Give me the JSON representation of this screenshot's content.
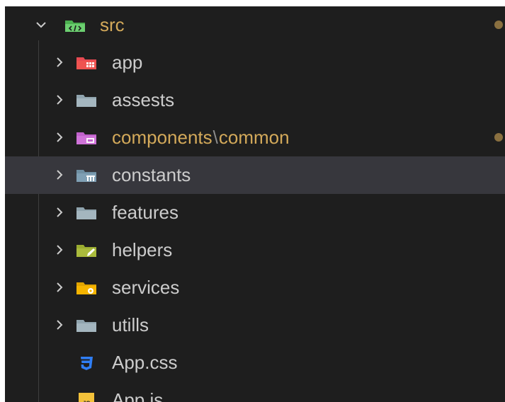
{
  "explorer": {
    "root": {
      "label": "src",
      "icon": "src-folder-icon",
      "expanded": true,
      "modified": true,
      "color": "#d3a95a"
    },
    "items": [
      {
        "label": "app",
        "type": "folder",
        "icon": "app-folder-icon",
        "icon_color": "#e84a52",
        "expanded": false
      },
      {
        "label": "assests",
        "type": "folder",
        "icon": "folder-icon",
        "icon_color": "#90a4ae",
        "expanded": false
      },
      {
        "label": "components",
        "sep": "\\",
        "label2": "common",
        "type": "folder",
        "icon": "components-folder-icon",
        "icon_color": "#c061cb",
        "expanded": false,
        "modified": true
      },
      {
        "label": "constants",
        "type": "folder",
        "icon": "constants-folder-icon",
        "icon_color": "#7f9fb4",
        "expanded": false,
        "selected": true
      },
      {
        "label": "features",
        "type": "folder",
        "icon": "folder-icon",
        "icon_color": "#90a4ae",
        "expanded": false
      },
      {
        "label": "helpers",
        "type": "folder",
        "icon": "helpers-folder-icon",
        "icon_color": "#aabb3c",
        "expanded": false
      },
      {
        "label": "services",
        "type": "folder",
        "icon": "services-folder-icon",
        "icon_color": "#f5b400",
        "expanded": false
      },
      {
        "label": "utills",
        "type": "folder",
        "icon": "folder-icon",
        "icon_color": "#90a4ae",
        "expanded": false
      },
      {
        "label": "App.css",
        "type": "file",
        "icon": "css-file-icon",
        "icon_color": "#2f7ef5"
      },
      {
        "label": "App.js",
        "type": "file",
        "icon": "js-file-icon",
        "icon_badge": "JS",
        "icon_color": "#f3c13a"
      }
    ],
    "colors": {
      "background": "#1e1e1e",
      "selected_row": "#37373d",
      "text": "#cccccc",
      "modified_text": "#d3a95a",
      "modified_dot": "#8a7040"
    }
  }
}
